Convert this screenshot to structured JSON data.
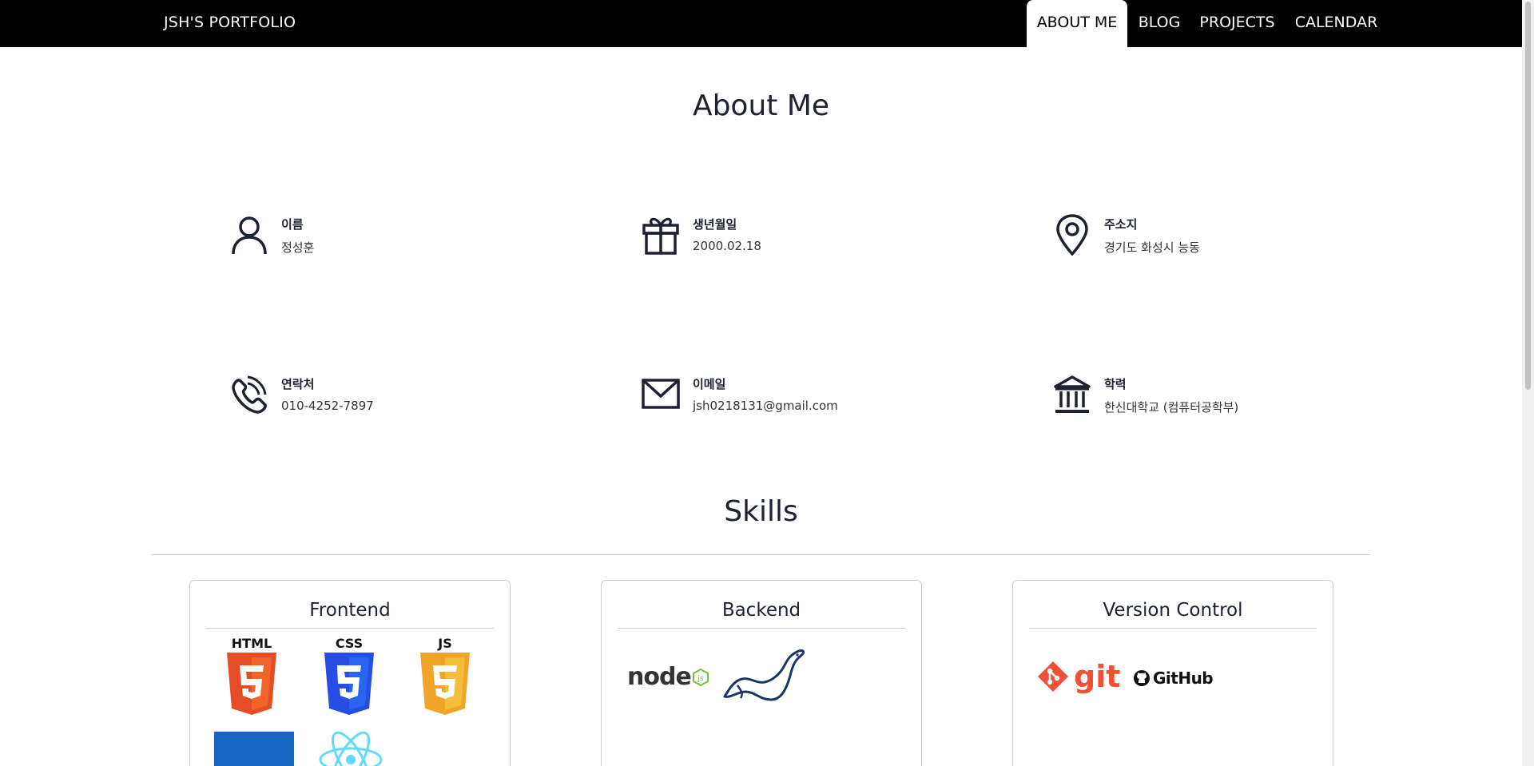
{
  "navbar": {
    "brand": "JSH'S PORTFOLIO",
    "items": [
      "ABOUT ME",
      "BLOG",
      "PROJECTS",
      "CALENDAR"
    ],
    "active_index": 0
  },
  "about": {
    "title": "About Me",
    "items": [
      {
        "icon": "person-icon",
        "label": "이름",
        "value": "정성훈"
      },
      {
        "icon": "gift-icon",
        "label": "생년월일",
        "value": "2000.02.18"
      },
      {
        "icon": "location-pin-icon",
        "label": "주소지",
        "value": "경기도 화성시 능동"
      },
      {
        "icon": "phone-icon",
        "label": "연락처",
        "value": "010-4252-7897"
      },
      {
        "icon": "envelope-icon",
        "label": "이메일",
        "value": "jsh0218131@gmail.com"
      },
      {
        "icon": "bank-icon",
        "label": "학력",
        "value": "한신대학교 (컴퓨터공학부)"
      }
    ]
  },
  "skills": {
    "title": "Skills",
    "cards": [
      {
        "title": "Frontend",
        "logos": [
          "HTML",
          "CSS",
          "JS"
        ]
      },
      {
        "title": "Backend",
        "logos": [
          "node",
          "mariadb-seal-logo"
        ]
      },
      {
        "title": "Version Control",
        "logos": [
          "git",
          "GitHub"
        ]
      }
    ]
  },
  "colors": {
    "nav_bg": "#000000",
    "text_dark": "#1d2130",
    "html_orange": "#e44d26",
    "css_blue": "#264de4",
    "js_gold": "#f0a428",
    "node_green": "#7bbe3c",
    "git_orange": "#f05033",
    "react_cyan": "#61dafb",
    "tile_blue": "#1565c0"
  }
}
